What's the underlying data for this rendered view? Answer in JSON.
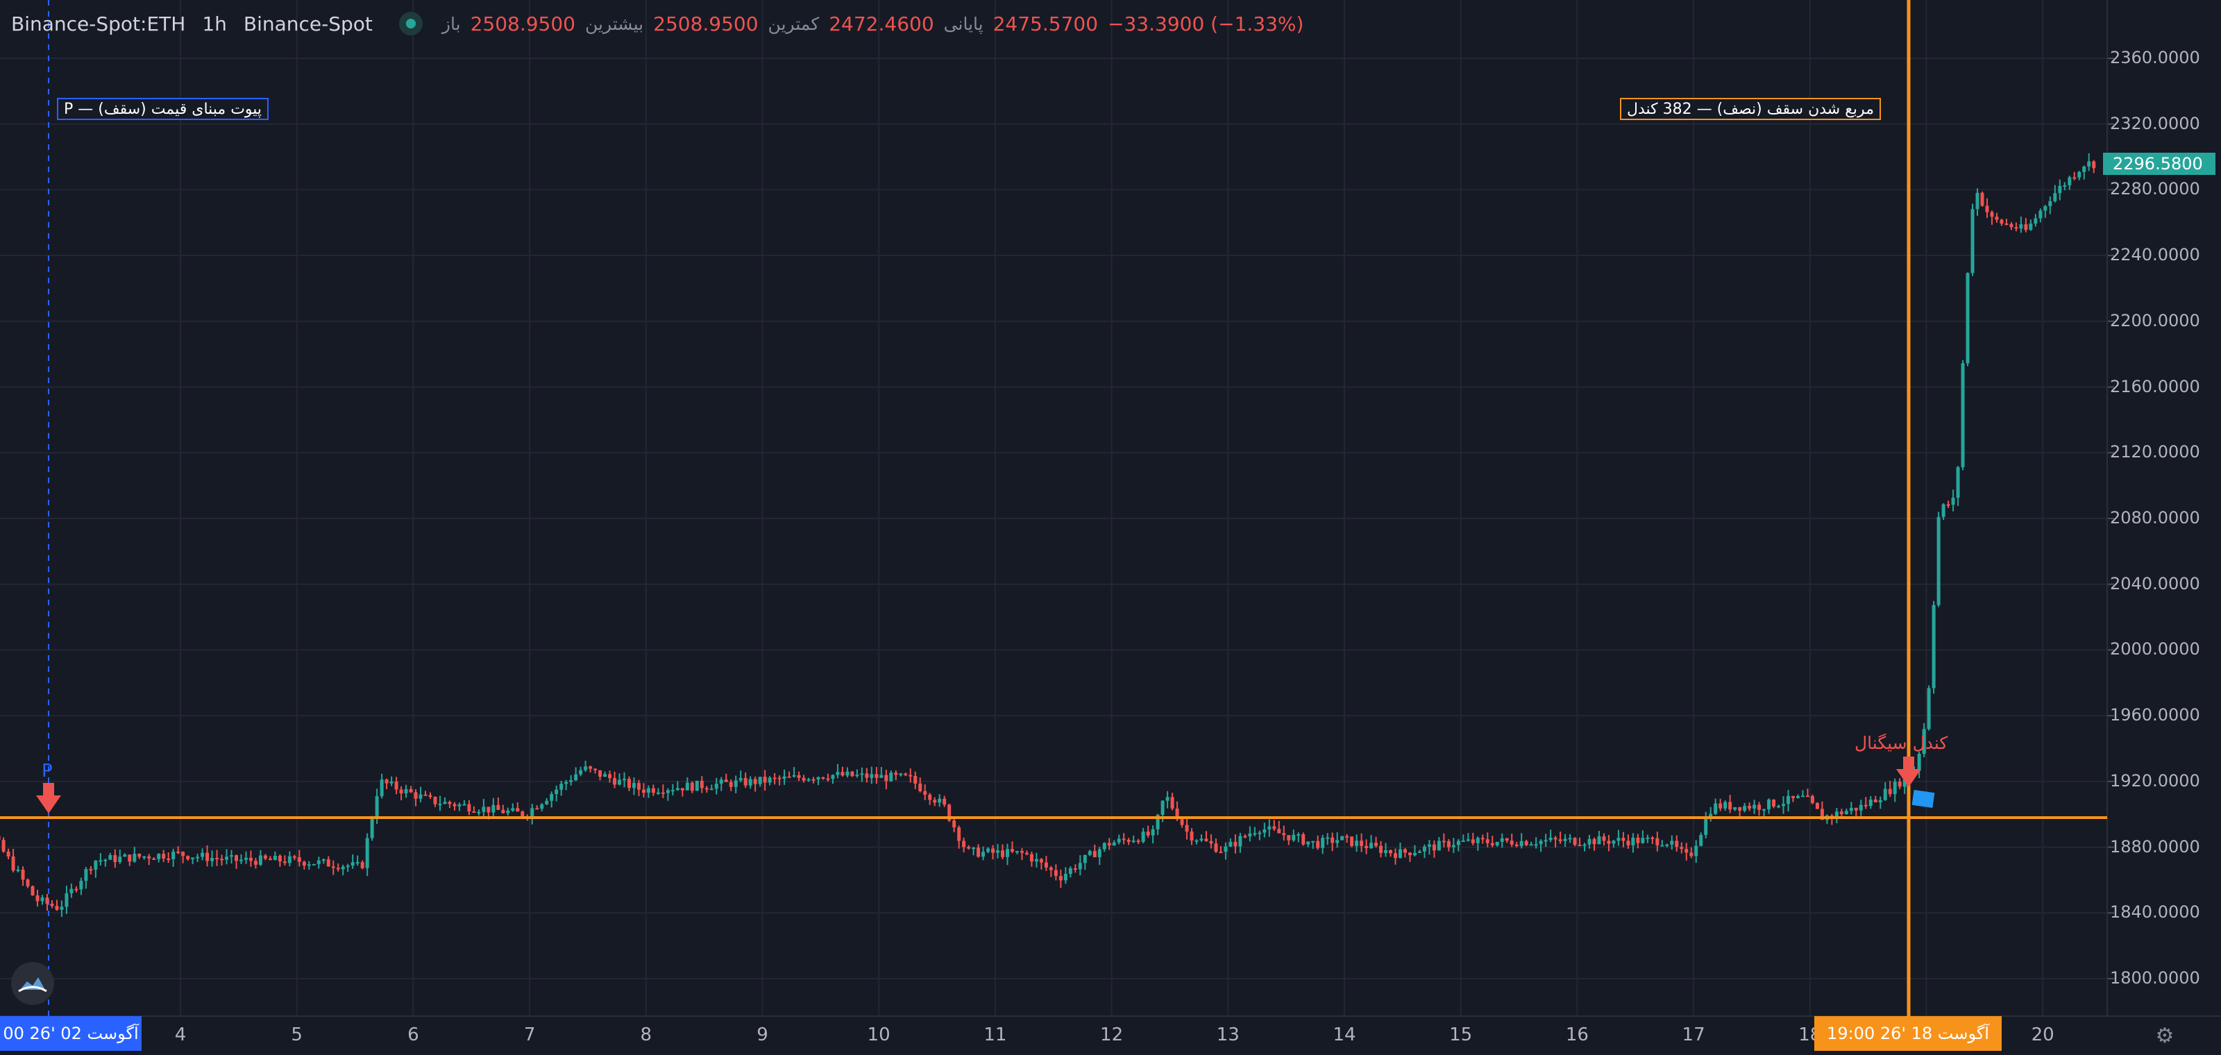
{
  "header": {
    "symbol": "Binance-Spot:ETH",
    "timeframe": "1h",
    "exchange": "Binance-Spot",
    "ohlc": {
      "open_label": "باز",
      "open": "2508.9500",
      "high_label": "بیشترین",
      "high": "2508.9500",
      "low_label": "کمترین",
      "low": "2472.4600",
      "close_label": "پایانی",
      "close": "2475.5700",
      "change": "−33.3900 (−1.33%)"
    }
  },
  "annotations": {
    "pivot_note": "P — پیوت مبنای قیمت (سقف)",
    "square_note": "مربع شدن سقف (نصف) — 382 کندل",
    "signal_label": "کندل سیگنال",
    "pivot_marker": "P"
  },
  "price_axis": {
    "labels": [
      "2360.0000",
      "2320.0000",
      "2280.0000",
      "2240.0000",
      "2200.0000",
      "2160.0000",
      "2120.0000",
      "2080.0000",
      "2040.0000",
      "2000.0000",
      "1960.0000",
      "1920.0000",
      "1880.0000",
      "1840.0000",
      "1800.0000"
    ],
    "last_price": "2296.5800"
  },
  "time_axis": {
    "labels": [
      "4",
      "5",
      "6",
      "7",
      "8",
      "9",
      "10",
      "11",
      "12",
      "13",
      "14",
      "15",
      "16",
      "17",
      "18",
      "19",
      "20"
    ],
    "start_tag": "00   26' آگوست 02",
    "signal_tag": "19:00   26' آگوست 18"
  },
  "colors": {
    "up": "#26a69a",
    "down": "#ef5350",
    "pivot_line": "#f7931a",
    "background": "#161a25"
  },
  "chart_data": {
    "type": "candlestick",
    "symbol": "ETH",
    "interval": "1h",
    "y_range": [
      1780,
      2380
    ],
    "pivot_level": 1898,
    "last_price": 2296.58,
    "daily_path": [
      {
        "day": 2.0,
        "price": 1868
      },
      {
        "day": 2.35,
        "price": 1895
      },
      {
        "day": 2.8,
        "price": 1848
      },
      {
        "day": 3.0,
        "price": 1843
      },
      {
        "day": 3.3,
        "price": 1872
      },
      {
        "day": 4.0,
        "price": 1876
      },
      {
        "day": 4.5,
        "price": 1872
      },
      {
        "day": 5.0,
        "price": 1872
      },
      {
        "day": 5.6,
        "price": 1868
      },
      {
        "day": 5.75,
        "price": 1920
      },
      {
        "day": 6.2,
        "price": 1908
      },
      {
        "day": 7.0,
        "price": 1900
      },
      {
        "day": 7.5,
        "price": 1928
      },
      {
        "day": 8.0,
        "price": 1915
      },
      {
        "day": 9.0,
        "price": 1920
      },
      {
        "day": 9.6,
        "price": 1924
      },
      {
        "day": 10.3,
        "price": 1922
      },
      {
        "day": 10.6,
        "price": 1905
      },
      {
        "day": 10.8,
        "price": 1877
      },
      {
        "day": 11.3,
        "price": 1876
      },
      {
        "day": 11.6,
        "price": 1862
      },
      {
        "day": 12.0,
        "price": 1882
      },
      {
        "day": 12.4,
        "price": 1888
      },
      {
        "day": 12.5,
        "price": 1912
      },
      {
        "day": 12.7,
        "price": 1888
      },
      {
        "day": 13.0,
        "price": 1878
      },
      {
        "day": 13.3,
        "price": 1892
      },
      {
        "day": 13.8,
        "price": 1882
      },
      {
        "day": 14.0,
        "price": 1885
      },
      {
        "day": 14.5,
        "price": 1876
      },
      {
        "day": 15.0,
        "price": 1883
      },
      {
        "day": 16.0,
        "price": 1884
      },
      {
        "day": 16.8,
        "price": 1884
      },
      {
        "day": 17.0,
        "price": 1873
      },
      {
        "day": 17.2,
        "price": 1905
      },
      {
        "day": 17.6,
        "price": 1905
      },
      {
        "day": 18.0,
        "price": 1910
      },
      {
        "day": 18.15,
        "price": 1898
      },
      {
        "day": 18.5,
        "price": 1905
      },
      {
        "day": 18.75,
        "price": 1916
      },
      {
        "day": 18.95,
        "price": 1928
      },
      {
        "day": 19.05,
        "price": 1962
      },
      {
        "day": 19.15,
        "price": 2085
      },
      {
        "day": 19.3,
        "price": 2092
      },
      {
        "day": 19.38,
        "price": 2212
      },
      {
        "day": 19.45,
        "price": 2282
      },
      {
        "day": 19.6,
        "price": 2262
      },
      {
        "day": 19.9,
        "price": 2255
      },
      {
        "day": 20.1,
        "price": 2275
      },
      {
        "day": 20.4,
        "price": 2296
      }
    ]
  }
}
